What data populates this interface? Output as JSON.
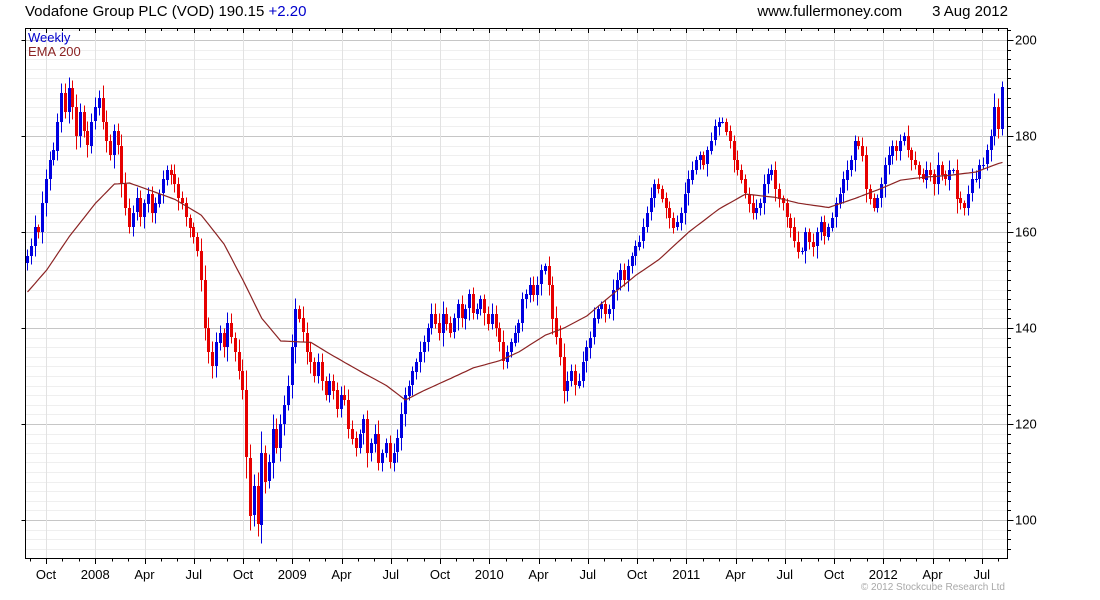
{
  "header": {
    "instrument": "Vodafone Group PLC (VOD)",
    "last_price": "190.15",
    "change": "+2.20",
    "website": "www.fullermoney.com",
    "date": "3 Aug 2012"
  },
  "legend": {
    "weekly": "Weekly",
    "ema": "EMA 200"
  },
  "footer": {
    "copyright": "© 2012 Stockcube Research Ltd"
  },
  "colors": {
    "change_text": "#0000cc",
    "legend_weekly": "#0000cc",
    "legend_ema": "#8b2323",
    "grid_minor": "#efefef",
    "grid_major": "#c6c6c6",
    "grid_vertical": "#e2e2e2",
    "axis_line": "#000000",
    "label_text": "#000000",
    "copyright_text": "#a8a8a8"
  },
  "chart_data": {
    "type": "candlestick",
    "title": "Vodafone Group PLC (VOD) weekly candlesticks with 200-period EMA",
    "last_close": 190.15,
    "change": 2.2,
    "weeks_total": 259,
    "noise_seed": 11,
    "x_axis": {
      "quarter_labels": [
        "Oct",
        "2008",
        "Apr",
        "Jul",
        "Oct",
        "2009",
        "Apr",
        "Jul",
        "Oct",
        "2010",
        "Apr",
        "Jul",
        "Oct",
        "2011",
        "Apr",
        "Jul",
        "Oct",
        "2012",
        "Apr",
        "Jul"
      ],
      "minor_ticks_per_quarter": 3
    },
    "y_axis": {
      "tick_labels": [
        200,
        180,
        160,
        140,
        120,
        100
      ],
      "major_step": 20,
      "minor_step": 2,
      "price_range": [
        92,
        202.4
      ]
    },
    "series": [
      {
        "name": "Weekly",
        "type": "candlestick",
        "up_color": "#0000e0",
        "down_color": "#e60000",
        "closes": [
          155,
          157,
          161,
          160,
          166,
          171,
          175,
          177,
          183,
          189,
          185,
          190,
          186,
          180,
          185,
          181,
          178,
          183,
          186,
          188,
          183,
          179,
          176,
          181,
          178,
          170,
          165,
          161,
          164,
          167,
          163,
          166,
          168,
          164,
          166,
          168,
          171,
          173,
          172,
          170,
          167,
          166,
          163,
          161,
          159,
          156,
          150,
          140,
          135,
          132,
          137,
          139,
          136,
          141,
          138,
          135,
          131,
          127,
          113,
          101,
          107,
          99,
          114,
          108,
          112,
          119,
          115,
          120,
          124,
          128,
          136,
          144,
          142,
          139,
          135,
          133,
          130,
          133,
          129,
          126,
          129,
          127,
          123,
          126,
          125,
          119,
          117,
          115,
          118,
          121,
          114,
          116,
          118,
          112,
          114,
          116,
          112,
          114,
          117,
          122,
          126,
          128,
          131,
          133,
          135,
          137,
          140,
          143,
          141,
          139,
          143,
          141,
          139,
          142,
          145,
          142,
          144,
          147,
          143,
          144,
          146,
          143,
          141,
          143,
          140,
          137,
          133,
          135,
          137,
          139,
          141,
          146,
          147,
          149,
          147,
          149,
          152,
          153,
          149,
          142,
          138,
          134,
          127,
          129,
          131,
          128,
          129,
          133,
          136,
          138,
          142,
          144,
          145,
          143,
          144,
          148,
          150,
          152,
          150,
          153,
          155,
          157,
          158,
          161,
          164,
          167,
          170,
          169,
          167,
          165,
          163,
          161,
          162,
          164,
          168,
          171,
          173,
          175,
          176,
          174,
          177,
          179,
          182,
          183,
          183,
          181,
          179,
          175,
          173,
          171,
          168,
          166,
          164,
          165,
          166,
          170,
          172,
          173,
          169,
          167,
          166,
          163,
          161,
          158,
          156,
          156,
          160,
          158,
          157,
          160,
          162,
          159,
          161,
          163,
          166,
          168,
          171,
          173,
          175,
          179,
          178,
          176,
          169,
          167,
          165,
          167,
          170,
          174,
          176,
          178,
          177,
          179,
          180,
          177,
          175,
          174,
          172,
          171,
          173,
          172,
          170,
          174,
          172,
          171,
          173,
          173,
          167,
          166,
          165,
          168,
          171,
          171,
          174,
          174,
          177,
          180,
          186,
          181.5,
          190.15
        ]
      },
      {
        "name": "EMA 200",
        "type": "line",
        "color": "#8b2323",
        "keypoints": [
          [
            0,
            147.5
          ],
          [
            5,
            152
          ],
          [
            11,
            159
          ],
          [
            18,
            166
          ],
          [
            23,
            170
          ],
          [
            27,
            170.2
          ],
          [
            32,
            168.8
          ],
          [
            39,
            166.8
          ],
          [
            46,
            163.5
          ],
          [
            52,
            157.5
          ],
          [
            57,
            150
          ],
          [
            62,
            142
          ],
          [
            67,
            137.3
          ],
          [
            75,
            137
          ],
          [
            80,
            134.6
          ],
          [
            88,
            131
          ],
          [
            95,
            128
          ],
          [
            100,
            125
          ],
          [
            105,
            127
          ],
          [
            112,
            129.5
          ],
          [
            118,
            131.7
          ],
          [
            125,
            133.2
          ],
          [
            130,
            135
          ],
          [
            137,
            138.5
          ],
          [
            142,
            140
          ],
          [
            148,
            142.5
          ],
          [
            154,
            146.5
          ],
          [
            161,
            151
          ],
          [
            167,
            154.2
          ],
          [
            175,
            160
          ],
          [
            183,
            164.8
          ],
          [
            190,
            167.9
          ],
          [
            198,
            167.2
          ],
          [
            204,
            166
          ],
          [
            212,
            165.1
          ],
          [
            219,
            167
          ],
          [
            226,
            169.1
          ],
          [
            231,
            170.8
          ],
          [
            237,
            171.4
          ],
          [
            244,
            171.8
          ],
          [
            251,
            172.5
          ],
          [
            257,
            174.3
          ],
          [
            258,
            174.5
          ]
        ]
      }
    ]
  }
}
